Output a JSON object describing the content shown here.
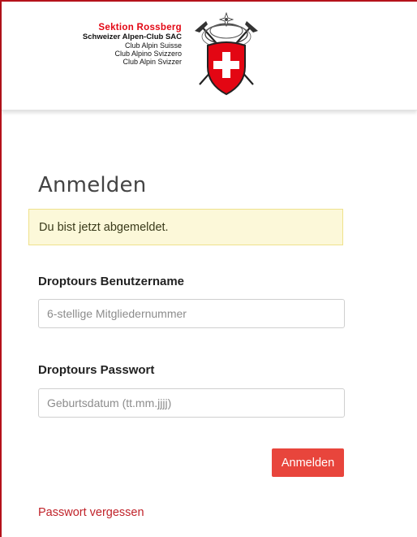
{
  "header": {
    "section_name": "Sektion Rossberg",
    "club_lines": [
      "Schweizer Alpen-Club SAC",
      "Club Alpin Suisse",
      "Club Alpino Svizzero",
      "Club Alpin Svizzer"
    ]
  },
  "page": {
    "title": "Anmelden"
  },
  "alert": {
    "message": "Du bist jetzt abgemeldet."
  },
  "form": {
    "username_label": "Droptours Benutzername",
    "username_placeholder": "6-stellige Mitgliedernummer",
    "password_label": "Droptours Passwort",
    "password_placeholder": "Geburtsdatum (tt.mm.jjjj)",
    "submit_label": "Anmelden",
    "forgot_link": "Passwort vergessen"
  },
  "colors": {
    "brand_red": "#e30613",
    "button_red": "#e8453c",
    "alert_bg": "#fcf8d9",
    "link_red": "#c0232a"
  }
}
